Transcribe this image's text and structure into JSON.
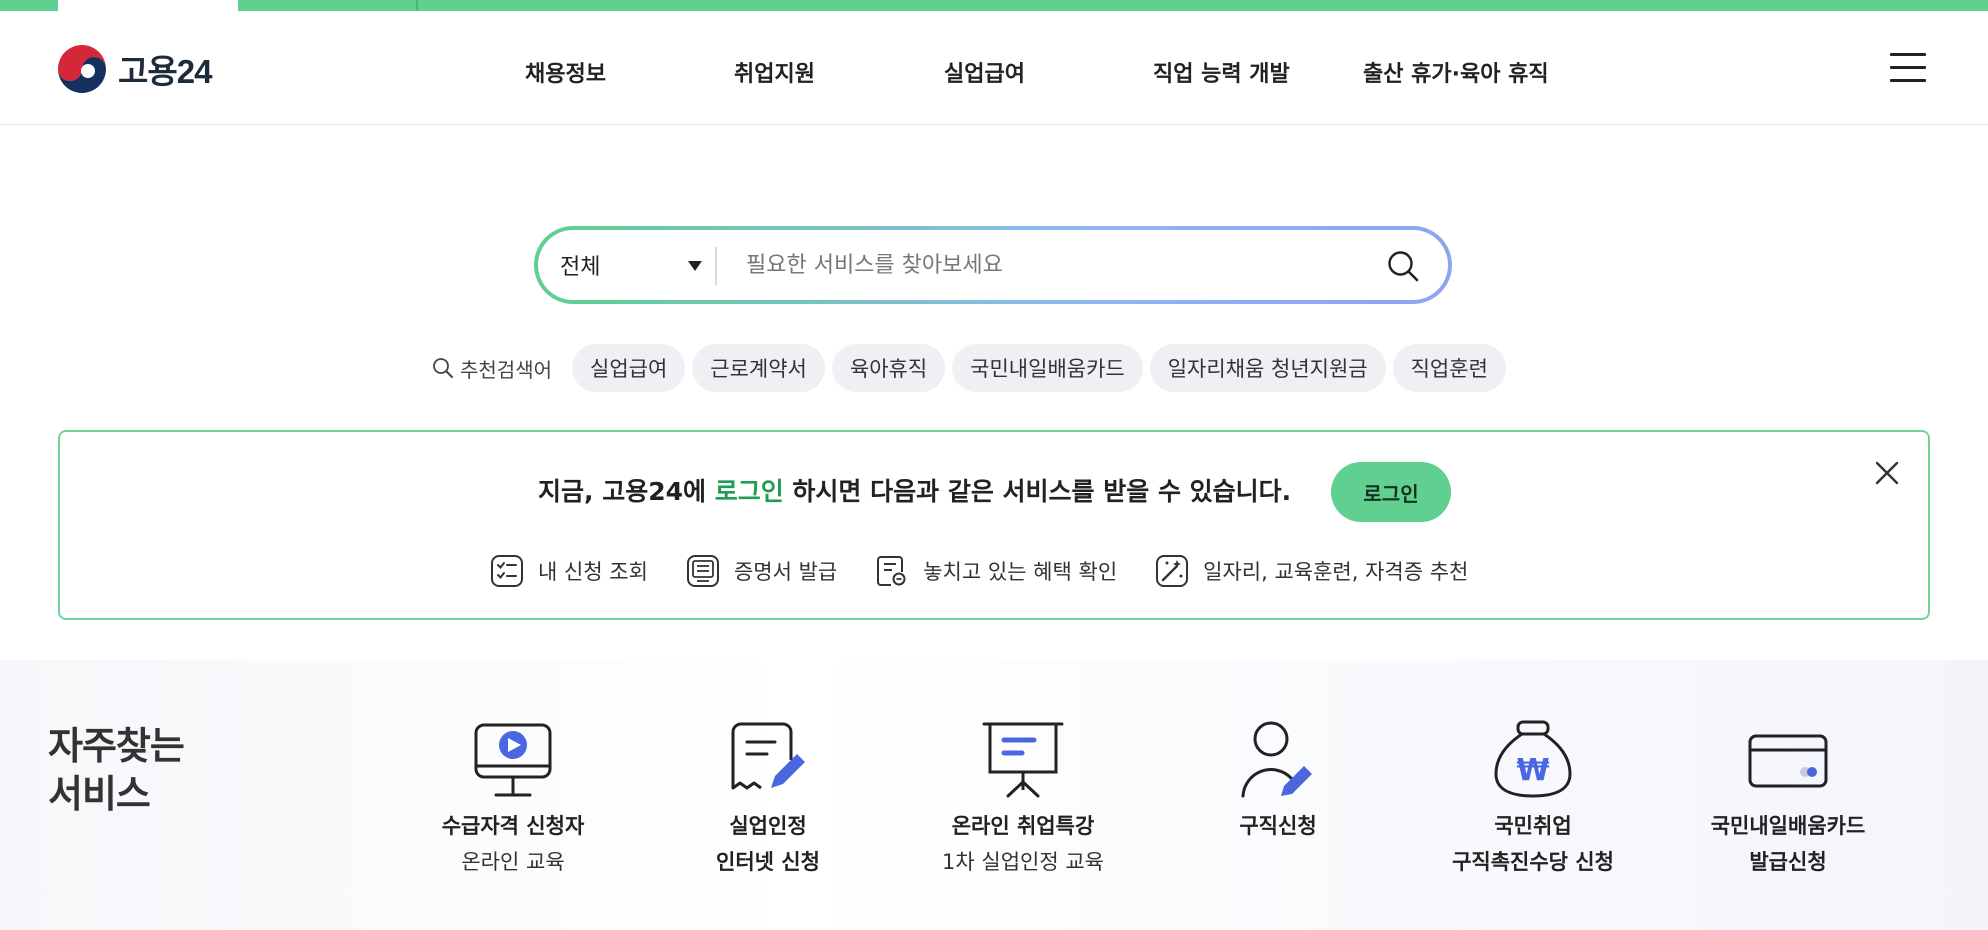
{
  "brand": {
    "name": "고용24",
    "accent": "#5fd08f",
    "highlight": "#1f9e52"
  },
  "nav": {
    "items": [
      "채용정보",
      "취업지원",
      "실업급여",
      "직업 능력 개발",
      "출산 휴가·육아 휴직"
    ],
    "menu_icon": "hamburger-icon"
  },
  "search": {
    "category": "전체",
    "placeholder": "필요한 서비스를 찾아보세요",
    "value": ""
  },
  "keywords": {
    "label": "추천검색어",
    "items": [
      "실업급여",
      "근로계약서",
      "육아휴직",
      "국민내일배움카드",
      "일자리채움 청년지원금",
      "직업훈련"
    ]
  },
  "banner": {
    "title_prefix": "지금, 고용24에 ",
    "title_link": "로그인",
    "title_suffix": " 하시면 다음과 같은 서비스를 받을 수 있습니다.",
    "login_button": "로그인",
    "benefits": [
      "내 신청 조회",
      "증명서 발급",
      "놓치고 있는 혜택 확인",
      "일자리, 교육훈련, 자격증 추천"
    ]
  },
  "services": {
    "title_line1": "자주찾는",
    "title_line2": "서비스",
    "items": [
      {
        "line1": "수급자격 신청자",
        "line2": "온라인 교육",
        "icon": "monitor-play-icon"
      },
      {
        "line1": "실업인정",
        "line2": "인터넷 신청",
        "icon": "document-pen-icon"
      },
      {
        "line1": "온라인 취업특강",
        "line2": "1차 실업인정 교육",
        "icon": "presentation-board-icon"
      },
      {
        "line1": "구직신청",
        "line2": "",
        "icon": "person-pen-icon"
      },
      {
        "line1": "국민취업",
        "line2": "구직촉진수당 신청",
        "icon": "money-bag-icon"
      },
      {
        "line1": "국민내일배움카드",
        "line2": "발급신청",
        "icon": "card-icon"
      }
    ]
  }
}
